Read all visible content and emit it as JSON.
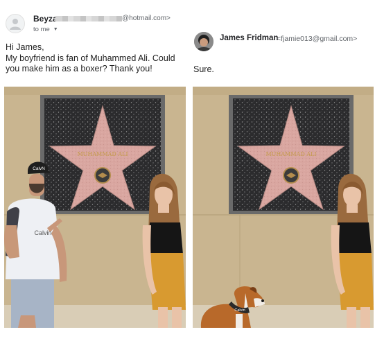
{
  "request_email": {
    "sender_name": "Beyza",
    "sender_domain": "@hotmail.com>",
    "to_label": "to me",
    "body": "Hi James,\nMy boyfriend is fan of Muhammed Ali. Could you make him as a boxer? Thank you!"
  },
  "reply_email": {
    "sender_name": "James Fridman",
    "sender_email": "<fjamie013@gmail.com>",
    "body": "Sure."
  },
  "photos": {
    "original_shirt_text": "Calvin",
    "edited_collar_text": "Calvin"
  },
  "icons": {
    "left_avatar": "person-icon",
    "to_dropdown": "chevron-down-icon"
  },
  "colors": {
    "star_pink": "#d9a6a0",
    "terrazzo": "#2b2b2d",
    "wall": "#c8b38e"
  }
}
